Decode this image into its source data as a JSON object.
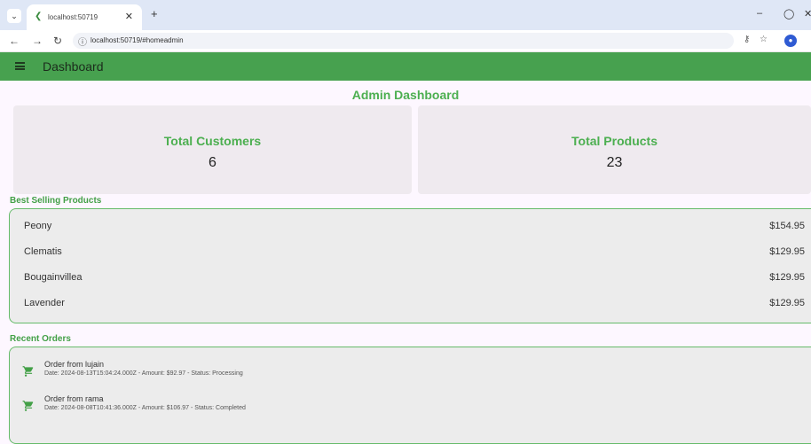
{
  "browser": {
    "tab_title": "localhost:50719",
    "url": "localhost:50719/#homeadmin",
    "accent": "#dfe7f6"
  },
  "appbar": {
    "title": "Dashboard",
    "color": "#47a14f"
  },
  "page": {
    "title": "Admin Dashboard",
    "accent": "#4caf50"
  },
  "stats": [
    {
      "label": "Total Customers",
      "value": "6"
    },
    {
      "label": "Total Products",
      "value": "23"
    }
  ],
  "best_selling": {
    "heading": "Best Selling Products",
    "items": [
      {
        "name": "Peony",
        "price": "$154.95"
      },
      {
        "name": "Clematis",
        "price": "$129.95"
      },
      {
        "name": "Bougainvillea",
        "price": "$129.95"
      },
      {
        "name": "Lavender",
        "price": "$129.95"
      }
    ]
  },
  "recent_orders": {
    "heading": "Recent Orders",
    "items": [
      {
        "title": "Order from lujain",
        "details": "Date: 2024-08-13T15:04:24.000Z - Amount: $92.97 - Status: Processing"
      },
      {
        "title": "Order from rama",
        "details": "Date: 2024-08-08T10:41:36.000Z - Amount: $106.97 - Status: Completed"
      }
    ]
  }
}
